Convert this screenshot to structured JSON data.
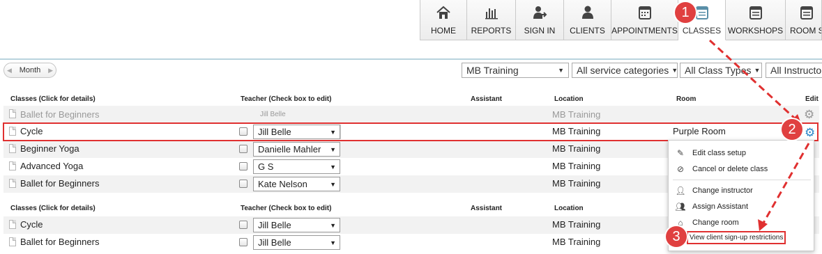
{
  "nav": {
    "tabs": [
      {
        "label": "HOME",
        "icon": "home-icon"
      },
      {
        "label": "REPORTS",
        "icon": "bar-chart-icon"
      },
      {
        "label": "SIGN IN",
        "icon": "user-signin-icon"
      },
      {
        "label": "CLIENTS",
        "icon": "user-icon"
      },
      {
        "label": "APPOINTMENTS",
        "icon": "calendar-icon"
      },
      {
        "label": "CLASSES",
        "icon": "calendar-icon",
        "active": true
      },
      {
        "label": "WORKSHOPS",
        "icon": "calendar-icon"
      },
      {
        "label": "ROOM S",
        "icon": "calendar-icon"
      }
    ]
  },
  "toolbar": {
    "month_label": "Month",
    "location_filter": "MB Training",
    "service_filter": "All service categories",
    "class_type_filter": "All Class Types",
    "instructor_filter": "All Instructor"
  },
  "columns": {
    "classes": "Classes (Click for details)",
    "teacher": "Teacher (Check box to edit)",
    "assistant": "Assistant",
    "location": "Location",
    "room": "Room",
    "edit": "Edit"
  },
  "section1": {
    "rows": [
      {
        "name": "Ballet for Beginners",
        "teacher": "Jill Belle",
        "location": "MB Training",
        "room": "",
        "disabled": true
      },
      {
        "name": "Cycle",
        "teacher": "Jill Belle",
        "location": "MB Training",
        "room": "Purple Room"
      },
      {
        "name": "Beginner Yoga",
        "teacher": "Danielle Mahler",
        "location": "MB Training",
        "room": ""
      },
      {
        "name": "Advanced Yoga",
        "teacher": "G S",
        "location": "MB Training",
        "room": ""
      },
      {
        "name": "Ballet for Beginners",
        "teacher": "Kate Nelson",
        "location": "MB Training",
        "room": ""
      }
    ]
  },
  "section2": {
    "rows": [
      {
        "name": "Cycle",
        "teacher": "Jill Belle",
        "location": "MB Training"
      },
      {
        "name": "Ballet for Beginners",
        "teacher": "Jill Belle",
        "location": "MB Training"
      }
    ]
  },
  "menu": {
    "edit_setup": "Edit class setup",
    "cancel_delete": "Cancel or delete class",
    "change_instructor": "Change instructor",
    "assign_assistant": "Assign Assistant",
    "change_room": "Change room",
    "view_restrictions": "View client sign-up restrictions"
  },
  "annotations": {
    "step1": "1",
    "step2": "2",
    "step3": "3",
    "color": "#e03030"
  }
}
